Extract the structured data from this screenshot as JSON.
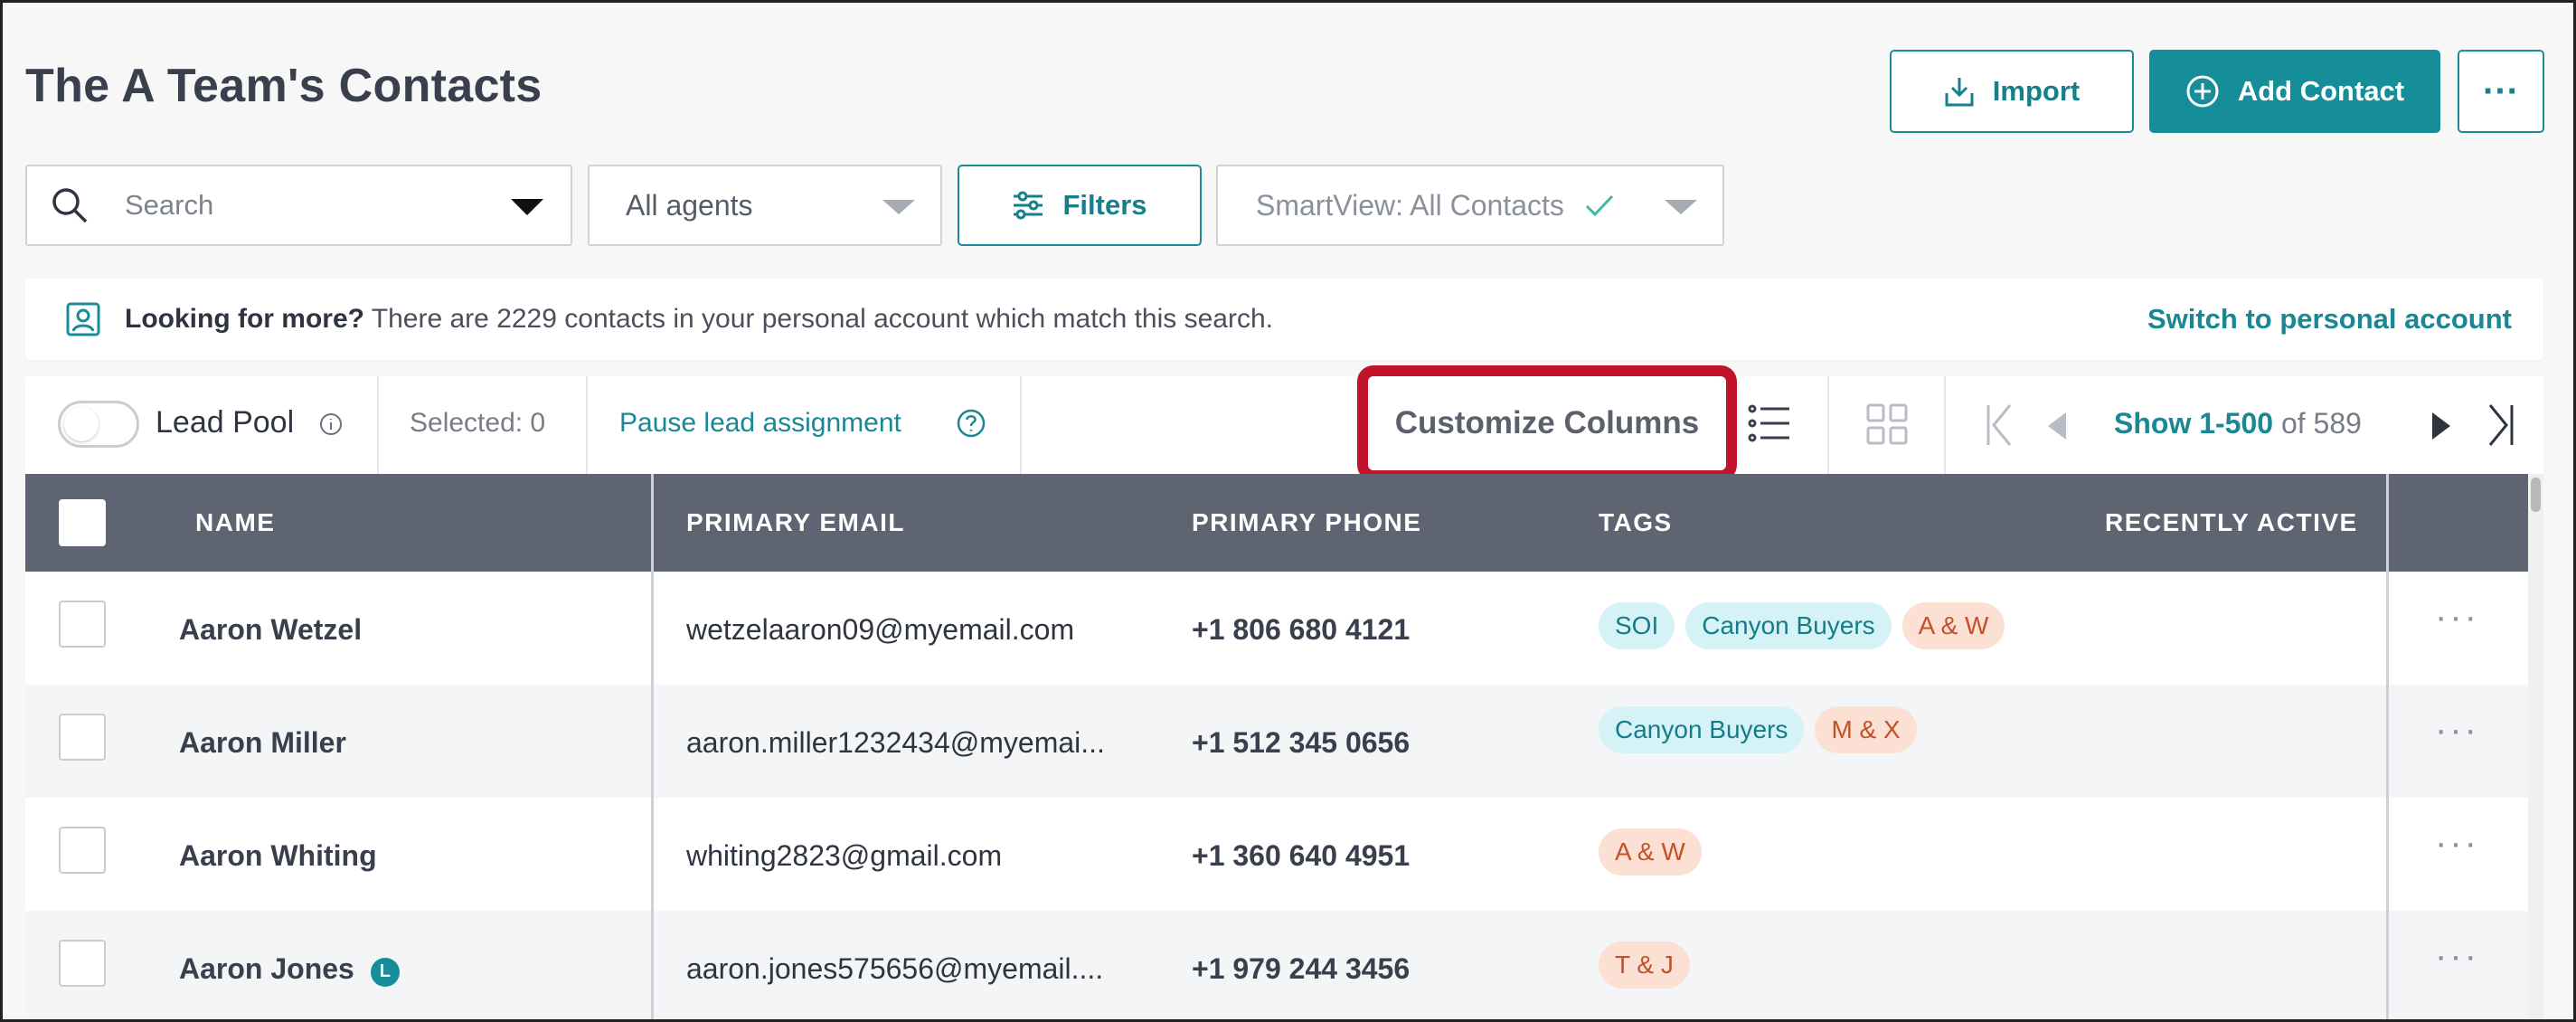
{
  "header": {
    "title": "The A Team's Contacts",
    "import_label": "Import",
    "add_contact_label": "Add Contact",
    "more_label": "···"
  },
  "search": {
    "placeholder": "Search",
    "agents_value": "All agents",
    "filters_label": "Filters",
    "smartview_value": "SmartView: All Contacts"
  },
  "banner": {
    "bold": "Looking for more?",
    "text": " There are 2229 contacts in your personal account which match this search.",
    "link": "Switch to personal account"
  },
  "toolbar": {
    "lead_pool_label": "Lead Pool",
    "selected_label": "Selected: 0",
    "pause_label": "Pause lead assignment",
    "customize_label": "Customize Columns",
    "pagination_range": "Show 1-500",
    "pagination_total": "of 589"
  },
  "table": {
    "columns": [
      "NAME",
      "PRIMARY EMAIL",
      "PRIMARY PHONE",
      "TAGS",
      "RECENTLY ACTIVE"
    ],
    "rows": [
      {
        "name": "Aaron Wetzel",
        "email": "wetzelaaron09@myemail.com",
        "phone": "+1 806 680 4121",
        "tags": [
          {
            "label": "SOI",
            "color": "blue"
          },
          {
            "label": "Canyon Buyers",
            "color": "blue"
          },
          {
            "label": "A & W",
            "color": "orange"
          }
        ],
        "badge": ""
      },
      {
        "name": "Aaron Miller",
        "email": "aaron.miller1232434@myemai...",
        "phone": "+1 512 345 0656",
        "tags": [
          {
            "label": "Canyon Buyers",
            "color": "blue"
          },
          {
            "label": "M & X",
            "color": "orange"
          }
        ],
        "badge": ""
      },
      {
        "name": "Aaron Whiting",
        "email": "whiting2823@gmail.com",
        "phone": "+1 360 640 4951",
        "tags": [
          {
            "label": "A & W",
            "color": "orange"
          }
        ],
        "badge": ""
      },
      {
        "name": "Aaron Jones",
        "email": "aaron.jones575656@myemail....",
        "phone": "+1 979 244 3456",
        "tags": [
          {
            "label": "T & J",
            "color": "orange"
          }
        ],
        "badge": "L"
      }
    ],
    "row_more_label": "···"
  },
  "colors": {
    "accent": "#168e9a",
    "header_bg": "#5f6473",
    "highlight": "#c2132a",
    "tag_blue_bg": "#d5f3f7",
    "tag_orange_bg": "#fbe0d3"
  },
  "icons": [
    "search-icon",
    "import-icon",
    "plus-circle-icon",
    "filters-icon",
    "check-icon",
    "contact-card-icon",
    "info-icon",
    "help-icon",
    "list-view-icon",
    "grid-view-icon",
    "first-page-icon",
    "prev-page-icon",
    "next-page-icon",
    "last-page-icon"
  ]
}
